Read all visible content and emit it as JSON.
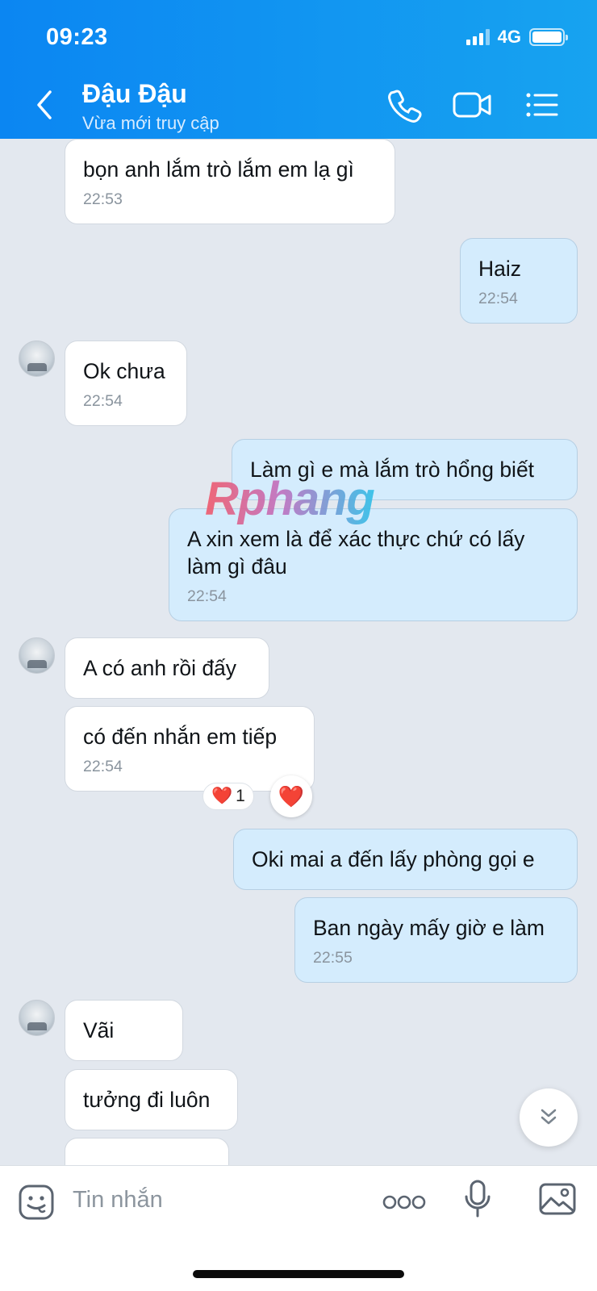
{
  "status_bar": {
    "time": "09:23",
    "network": "4G"
  },
  "header": {
    "contact_name": "Đậu Đậu",
    "contact_status": "Vừa mới truy cập"
  },
  "messages": [
    {
      "text": "bọn anh lắm trò lắm em lạ gì",
      "time": "22:53"
    },
    {
      "text": "Haiz",
      "time": "22:54"
    },
    {
      "text": "Ok chưa",
      "time": "22:54"
    },
    {
      "text": "Làm gì e mà lắm trò hổng biết"
    },
    {
      "text": "A xin xem là để xác thực chứ có lấy làm gì đâu",
      "time": "22:54"
    },
    {
      "text": "A có anh rồi đấy"
    },
    {
      "text": "có đến nhắn em tiếp",
      "time": "22:54"
    },
    {
      "text": "Oki mai a đến lấy phòng gọi e"
    },
    {
      "text": "Ban ngày mấy giờ e làm",
      "time": "22:55"
    },
    {
      "text": "Vãi"
    },
    {
      "text": "tưởng đi luôn"
    }
  ],
  "reaction": {
    "emoji": "❤️",
    "count": "1",
    "button_emoji": "❤️"
  },
  "watermark": "Rphang",
  "composer": {
    "placeholder": "Tin nhắn"
  },
  "icons": [
    "back-icon",
    "phone-icon",
    "video-call-icon",
    "menu-list-icon",
    "sticker-icon",
    "more-icon",
    "microphone-icon",
    "image-icon",
    "chevron-double-down-icon"
  ]
}
